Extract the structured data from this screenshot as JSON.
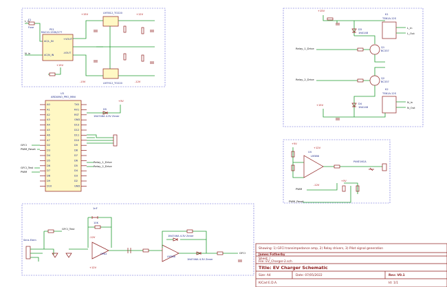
{
  "components": {
    "fuse": {
      "ref": "F1",
      "value": "Fuse"
    },
    "relay_module": {
      "ref": "PS1",
      "value": "RAC10-15SK/277",
      "pins": [
        "AC/L_IN",
        "AC/N_IN",
        "+VOUT",
        "-VOUT"
      ]
    },
    "reg_pos": {
      "ref": "U1",
      "value": "LM7812_TO220"
    },
    "reg_neg": {
      "ref": "U2",
      "value": "LM7912_TO220"
    },
    "mcu": {
      "ref": "U3",
      "value": "ARDUINO_PRO_MINI"
    },
    "zener_top": {
      "ref": "D5",
      "value": "1N4746A 4.3V Zener"
    },
    "relay1": {
      "ref": "K1",
      "value": "TSN1A-12S"
    },
    "relay2": {
      "ref": "K2",
      "value": "TSN1A-12S"
    },
    "tr1": {
      "ref": "Q1",
      "value": "BC337"
    },
    "tr2": {
      "ref": "Q2",
      "value": "BC337"
    },
    "diode1": {
      "ref": "D3",
      "value": "1N4148"
    },
    "diode2": {
      "ref": "D4",
      "value": "1N4148"
    },
    "opamp_pilot": {
      "ref": "U4",
      "value": "LM386"
    },
    "tvs": {
      "ref": "D6",
      "value": "P4KE16CA"
    },
    "opamp_a": {
      "ref": "U5",
      "value": "OPA2"
    },
    "opamp_b": {
      "ref": "U5",
      "value": "LM386"
    }
  },
  "nets": {
    "L_in": "L_in",
    "N_in": "N_in",
    "relay1_drive": "Relay_1_Drive",
    "relay2_drive": "Relay_2_Drive",
    "L_out": "L_Out",
    "N_out": "N_Out",
    "gfci": "GFCI",
    "gfci_test": "GFCI_Test",
    "pwm": "PWM",
    "pwm_reset": "PWM_Reset",
    "gfci_rst": "GFCI_Test",
    "cp": "CP"
  },
  "rails": {
    "p15": "+15V",
    "n15": "-15V",
    "p12": "+12V",
    "n12": "-12V",
    "p5": "+5V"
  },
  "mcu_pins_left": [
    "A0",
    "A1",
    "A2",
    "A3",
    "A4",
    "A5",
    "A6",
    "A7",
    "D2",
    "D3",
    "D4",
    "D5",
    "D6",
    "D7",
    "D8",
    "D9",
    "D10"
  ],
  "mcu_pins_right": [
    "TX0",
    "RX1",
    "RST",
    "GND",
    "D13",
    "D12",
    "D11",
    "D10",
    "D9",
    "D8",
    "D7",
    "D6",
    "D5",
    "D4",
    "D3",
    "D2",
    "GND"
  ],
  "mcu_net_labels": [
    "GFCI",
    "PWM_Reset",
    "GFCI_Test",
    "PWM"
  ],
  "mcu_relay_labels": [
    "Relay_1_Drive",
    "Relay_2_Drive"
  ],
  "transimpedance": {
    "sensor": "Sens Elem",
    "r_fb": "10K",
    "c_fb": "1nF"
  },
  "title_block": {
    "note": "Showing: 1) GFCI transimpedance amp, 2) Relay drivers, 3) Pilot signal generation",
    "author": "James Fotherby",
    "sheet": "Sheet: /",
    "file": "File: EV_Charger-2.sch",
    "title": "Title: EV Charger Schematic",
    "size": "Size: A4",
    "date": "Date: 07/05/2022",
    "rev": "Rev: V0.1",
    "kicad": "KiCad E.D.A.",
    "id": "Id: 1/1"
  },
  "colors": {
    "wire": "#1e9a2e",
    "component": "#8b1a1a",
    "label": "#1f2a8a",
    "sheet_box": "#5b5bd6",
    "mcu_fill": "#fff8c4"
  }
}
